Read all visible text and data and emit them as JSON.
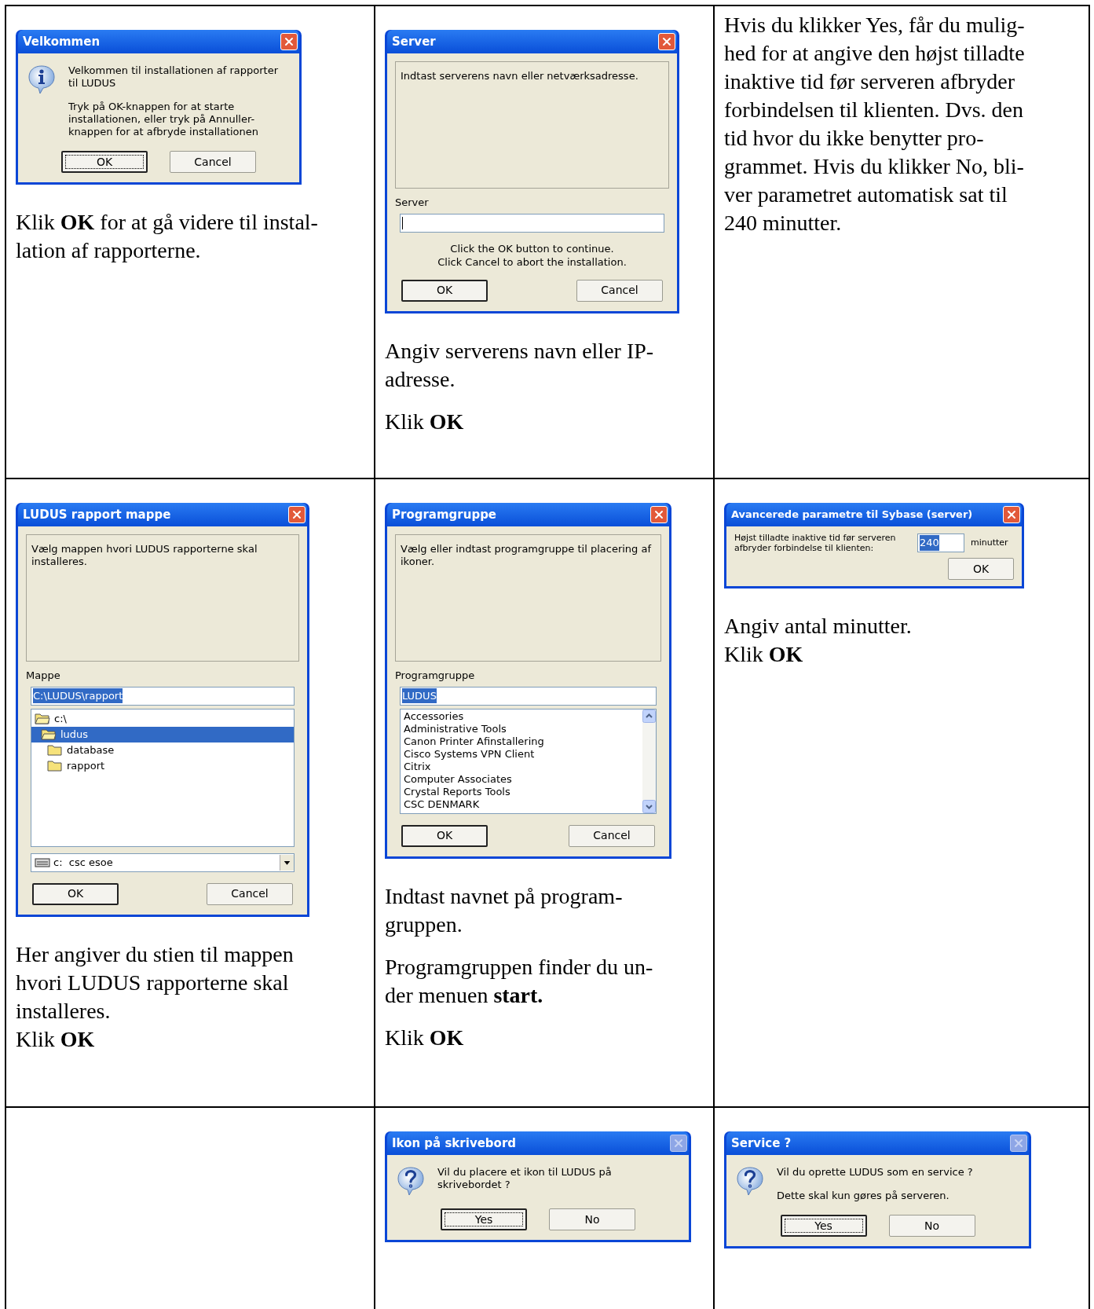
{
  "rows": [
    {
      "cells": [
        {
          "dialog": {
            "kind": "info",
            "title": "Velkommen",
            "close_disabled": false,
            "messages": [
              "Velkommen til installationen af rapporter til LUDUS",
              "Tryk på OK-knappen for at starte installationen, eller tryk på Annuller-knappen for at afbryde installationen"
            ],
            "buttons": [
              {
                "label": "OK",
                "default": true,
                "focused": true
              },
              {
                "label": "Cancel",
                "default": false,
                "focused": false
              }
            ]
          },
          "paragraphs": [
            [
              "Klik **OK** for at gå videre til instal-",
              "lation af rapporterne."
            ]
          ]
        },
        {
          "dialog": {
            "kind": "form",
            "title": "Server",
            "close_disabled": false,
            "description": "Indtast serverens navn eller netværksadresse.",
            "field_label": "Server",
            "notes": [
              "Click the OK button to continue.",
              "Click Cancel to abort the installation."
            ],
            "buttons": [
              {
                "label": "OK",
                "default": true,
                "focused": false
              },
              {
                "label": "Cancel",
                "default": false,
                "focused": false
              }
            ]
          },
          "paragraphs": [
            [
              "Angiv serverens navn eller IP-",
              "adresse."
            ],
            [
              "Klik **OK**"
            ]
          ]
        },
        {
          "paragraphs": [
            [
              "Hvis du klikker Yes, får du mulig-",
              "hed for at angive den højst tilladte",
              "inaktive tid før serveren afbryder",
              "forbindelsen til klienten. Dvs. den",
              "tid hvor du ikke benytter pro-",
              "grammet. Hvis du klikker No, bli-",
              "ver parametret automatisk sat til",
              "240 minutter."
            ]
          ]
        }
      ]
    },
    {
      "cells": [
        {
          "dialog": {
            "kind": "form",
            "title": "LUDUS rapport mappe",
            "close_disabled": false,
            "description": "Vælg mappen hvori LUDUS rapporterne skal installeres.",
            "field_label": "Mappe",
            "field_value": "C:\\LUDUS\\rapport",
            "field_selected": true,
            "tree": [
              {
                "label": "c:\\",
                "expanded": true,
                "selected": false,
                "children": [
                  {
                    "label": "ludus",
                    "expanded": true,
                    "selected": true,
                    "children": [
                      {
                        "label": "database",
                        "expanded": false,
                        "selected": false
                      },
                      {
                        "label": "rapport",
                        "expanded": false,
                        "selected": false
                      }
                    ]
                  }
                ]
              }
            ],
            "drive": "c:  csc esoe",
            "buttons": [
              {
                "label": "OK",
                "default": true,
                "focused": false
              },
              {
                "label": "Cancel",
                "default": false,
                "focused": false
              }
            ]
          },
          "paragraphs": [
            [
              "Her angiver du stien til mappen",
              "hvori LUDUS rapporterne skal",
              "installeres.",
              "Klik **OK**"
            ]
          ]
        },
        {
          "dialog": {
            "kind": "form",
            "title": "Programgruppe",
            "close_disabled": false,
            "description": "Vælg eller indtast programgruppe til placering af ikoner.",
            "field_label": "Programgruppe",
            "field_value": "LUDUS",
            "field_selected": true,
            "list": [
              "Accessories",
              "Administrative Tools",
              "Canon Printer Afinstallering",
              "Cisco Systems VPN Client",
              "Citrix",
              "Computer Associates",
              "Crystal Reports Tools",
              "CSC DENMARK"
            ],
            "buttons": [
              {
                "label": "OK",
                "default": true,
                "focused": false
              },
              {
                "label": "Cancel",
                "default": false,
                "focused": false
              }
            ]
          },
          "paragraphs": [
            [
              "Indtast navnet på program-",
              "gruppen."
            ],
            [
              "Programgruppen finder du un-",
              "der menuen **start.**"
            ],
            [
              "Klik **OK**"
            ]
          ]
        },
        {
          "dialog": {
            "kind": "inline",
            "title": "Avancerede parametre til Sybase (server)",
            "close_disabled": false,
            "prompt": "Højst tilladte inaktive tid før serveren afbryder forbindelse til klienten:",
            "field_value": "240",
            "field_selected": true,
            "unit": "minutter",
            "buttons": [
              {
                "label": "OK",
                "default": false,
                "focused": false
              }
            ]
          },
          "paragraphs": [
            [
              "Angiv antal minutter.",
              "Klik **OK**"
            ]
          ]
        }
      ]
    },
    {
      "cells": [
        {},
        {
          "dialog": {
            "kind": "question",
            "title": "Ikon på skrivebord",
            "close_disabled": true,
            "messages": [
              "Vil du placere et ikon til LUDUS på skrivebordet ?"
            ],
            "buttons": [
              {
                "label": "Yes",
                "default": true,
                "focused": true
              },
              {
                "label": "No",
                "default": false,
                "focused": false
              }
            ]
          }
        },
        {
          "dialog": {
            "kind": "question",
            "title": "Service ?",
            "close_disabled": true,
            "messages": [
              "Vil du oprette LUDUS som en service ?",
              "Dette skal kun gøres på serveren."
            ],
            "buttons": [
              {
                "label": "Yes",
                "default": true,
                "focused": true
              },
              {
                "label": "No",
                "default": false,
                "focused": false
              }
            ]
          }
        }
      ]
    }
  ]
}
